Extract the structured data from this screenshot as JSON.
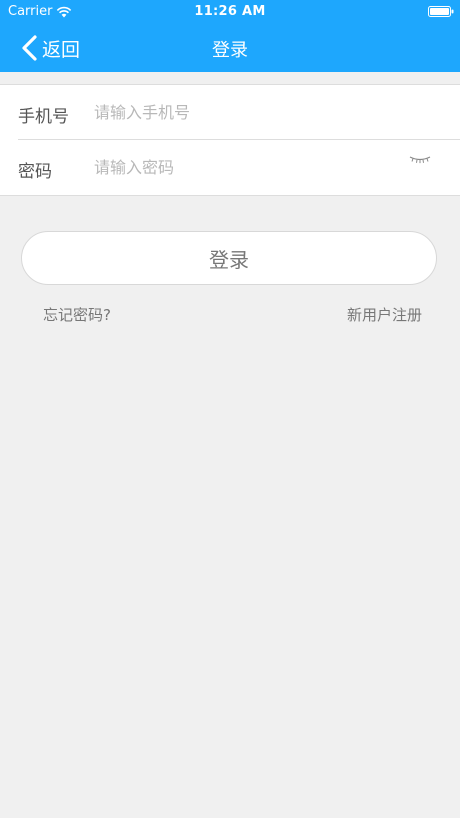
{
  "status_bar": {
    "carrier": "Carrier",
    "time": "11:26 AM",
    "wifi_icon": "wifi-icon",
    "battery_icon": "battery-icon"
  },
  "nav": {
    "back_label": "返回",
    "back_icon": "chevron-left-icon",
    "title": "登录"
  },
  "form": {
    "phone": {
      "label": "手机号",
      "placeholder": "请输入手机号",
      "value": ""
    },
    "password": {
      "label": "密码",
      "placeholder": "请输入密码",
      "value": "",
      "toggle_icon": "eye-closed-icon"
    }
  },
  "actions": {
    "login_label": "登录",
    "forgot_label": "忘记密码?",
    "register_label": "新用户注册"
  },
  "colors": {
    "header_bg": "#1ea7fd",
    "page_bg": "#f0f0f0",
    "text_gray": "#777777"
  }
}
